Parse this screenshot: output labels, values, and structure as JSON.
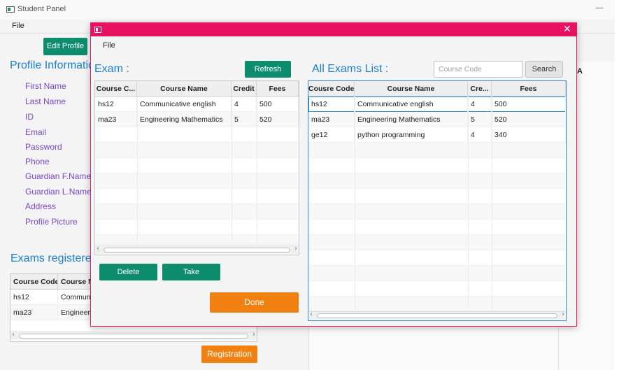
{
  "background_window": {
    "title": "Student Panel",
    "menu": [
      "File"
    ],
    "edit_profile_button": "Edit Profile",
    "profile_heading": "Profile Informatic",
    "profile_fields": [
      "First Name",
      "Last Name",
      "ID",
      "Email",
      "Password",
      "Phone",
      "Guardian F.Name",
      "Guardian L.Name",
      "Address",
      "Profile Picture"
    ],
    "exams_heading": "Exams registered",
    "exams_table": {
      "columns": [
        "Course Code",
        "Course Name"
      ],
      "rows": [
        [
          "hs12",
          "Communicative english"
        ],
        [
          "ma23",
          "Engineering Mathematics"
        ]
      ]
    },
    "registration_button": "Registration",
    "right_header_fragment": "A"
  },
  "modal": {
    "menu": [
      "File"
    ],
    "exam_heading": "Exam :",
    "refresh_button": "Refresh",
    "exam_table": {
      "columns": [
        "Course C...",
        "Course Name",
        "Credit",
        "Fees"
      ],
      "rows": [
        [
          "hs12",
          "Communicative english",
          "4",
          "500"
        ],
        [
          "ma23",
          "Engineering Mathematics",
          "5",
          "520"
        ]
      ]
    },
    "delete_button": "Delete",
    "take_button": "Take",
    "done_button": "Done",
    "all_exams_heading": "All Exams List :",
    "search": {
      "placeholder": "Course Code",
      "button": "Search"
    },
    "all_exams_table": {
      "columns": [
        "Cousre Code",
        "Course Name",
        "Cre...",
        "Fees"
      ],
      "rows": [
        [
          "hs12",
          "Communicative english",
          "4",
          "500"
        ],
        [
          "ma23",
          "Engineering Mathematics",
          "5",
          "520"
        ],
        [
          "ge12",
          "python programming",
          "4",
          "340"
        ]
      ]
    }
  },
  "colors": {
    "accent_teal": "#0d8c6e",
    "modal_pink": "#e8115f",
    "heading_blue": "#1a7fd1",
    "label_purple": "#7a43c9",
    "button_orange": "#f08010"
  }
}
